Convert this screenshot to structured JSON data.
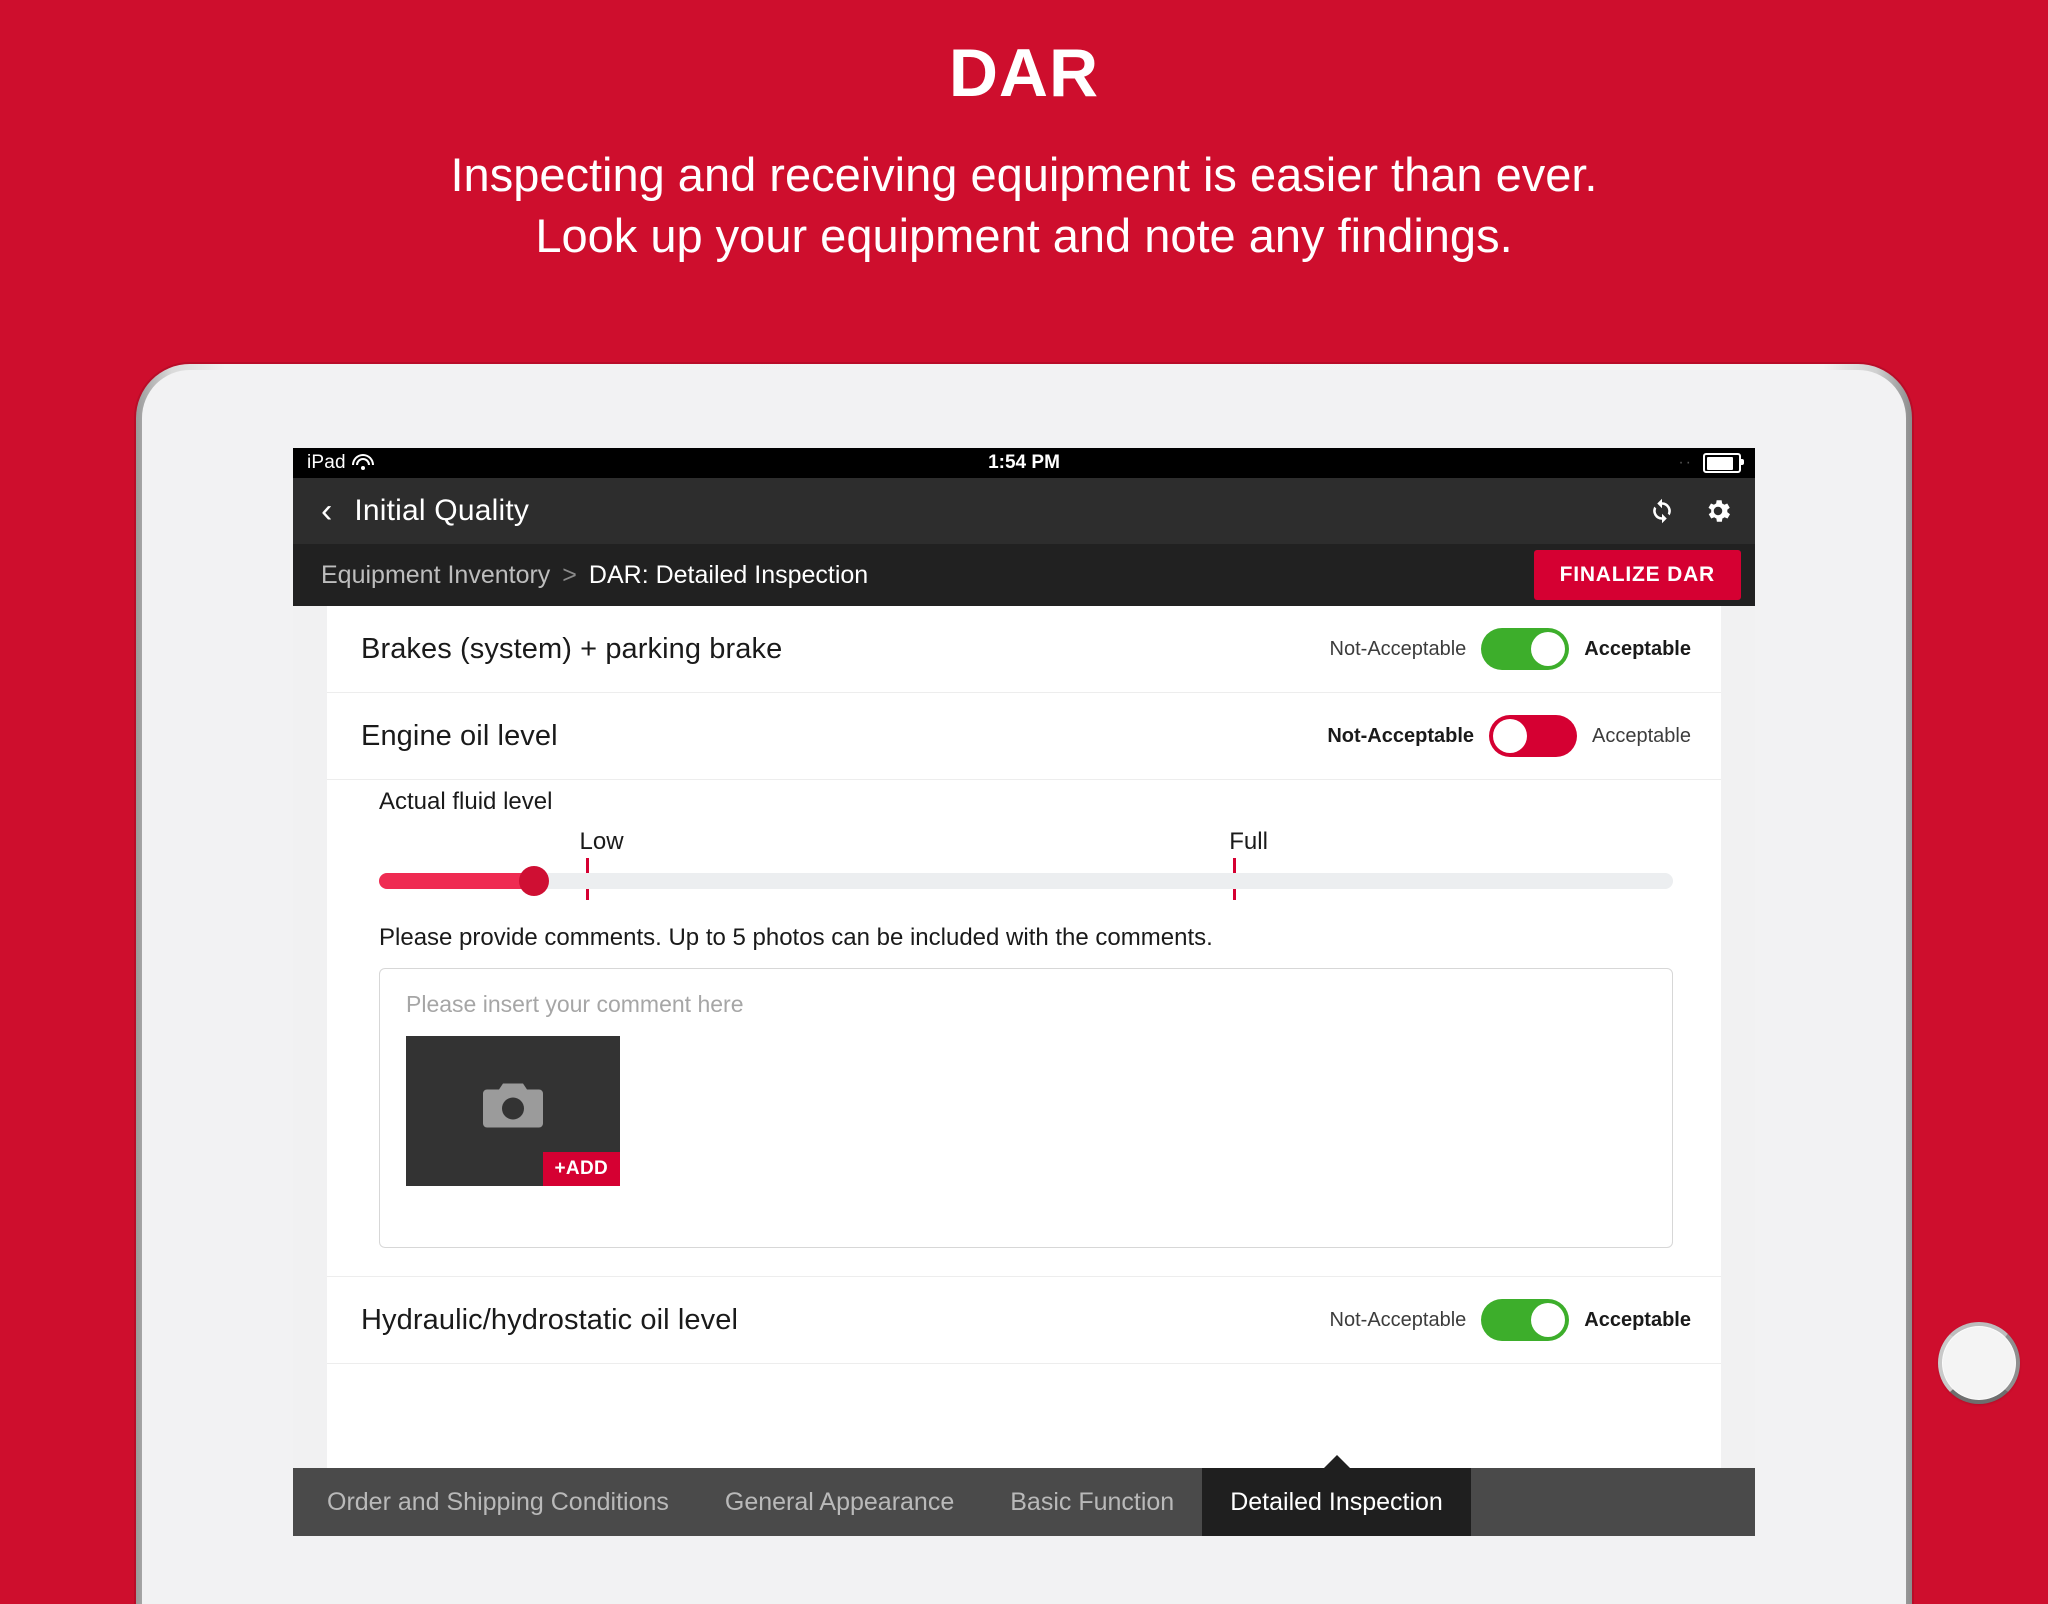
{
  "promo": {
    "title": "DAR",
    "subtitle_line1": "Inspecting and receiving equipment is easier than ever.",
    "subtitle_line2": "Look up your equipment and note any findings.",
    "background_color": "#ce0e2d"
  },
  "status_bar": {
    "carrier": "iPad",
    "wifi_icon": "wifi-icon",
    "time": "1:54 PM",
    "dots": "··",
    "battery_icon": "battery-icon"
  },
  "navbar": {
    "back_icon": "back-chevron-icon",
    "title": "Initial Quality",
    "sync_icon": "sync-refresh-icon",
    "settings_icon": "gear-icon"
  },
  "breadcrumb": {
    "parent": "Equipment Inventory",
    "separator": ">",
    "current": "DAR: Detailed Inspection",
    "finalize_label": "FINALIZE DAR",
    "finalize_color": "#d50032"
  },
  "toggle_labels": {
    "not_acceptable": "Not-Acceptable",
    "acceptable": "Acceptable",
    "on_color": "#3dae2b",
    "off_color": "#d50032"
  },
  "rows": [
    {
      "title": "Brakes (system) + parking brake",
      "state": "acceptable"
    },
    {
      "title": "Engine oil level",
      "state": "not-acceptable"
    },
    {
      "title": "Hydraulic/hydrostatic oil level",
      "state": "acceptable"
    }
  ],
  "fluid": {
    "label": "Actual fluid level",
    "low_label": "Low",
    "full_label": "Full",
    "value_percent": 12,
    "low_tick_percent": 16,
    "full_tick_percent": 66,
    "fill_color": "#ef2b52",
    "track_color": "#eceef0"
  },
  "comments": {
    "help_text": "Please provide comments. Up to 5 photos can be included with the comments.",
    "placeholder": "Please insert your comment here",
    "photo_icon": "camera-icon",
    "add_label": "+ADD",
    "max_photos": 5
  },
  "tabs": [
    {
      "label": "Order and Shipping Conditions",
      "active": false
    },
    {
      "label": "General Appearance",
      "active": false
    },
    {
      "label": "Basic Function",
      "active": false
    },
    {
      "label": "Detailed Inspection",
      "active": true
    }
  ]
}
